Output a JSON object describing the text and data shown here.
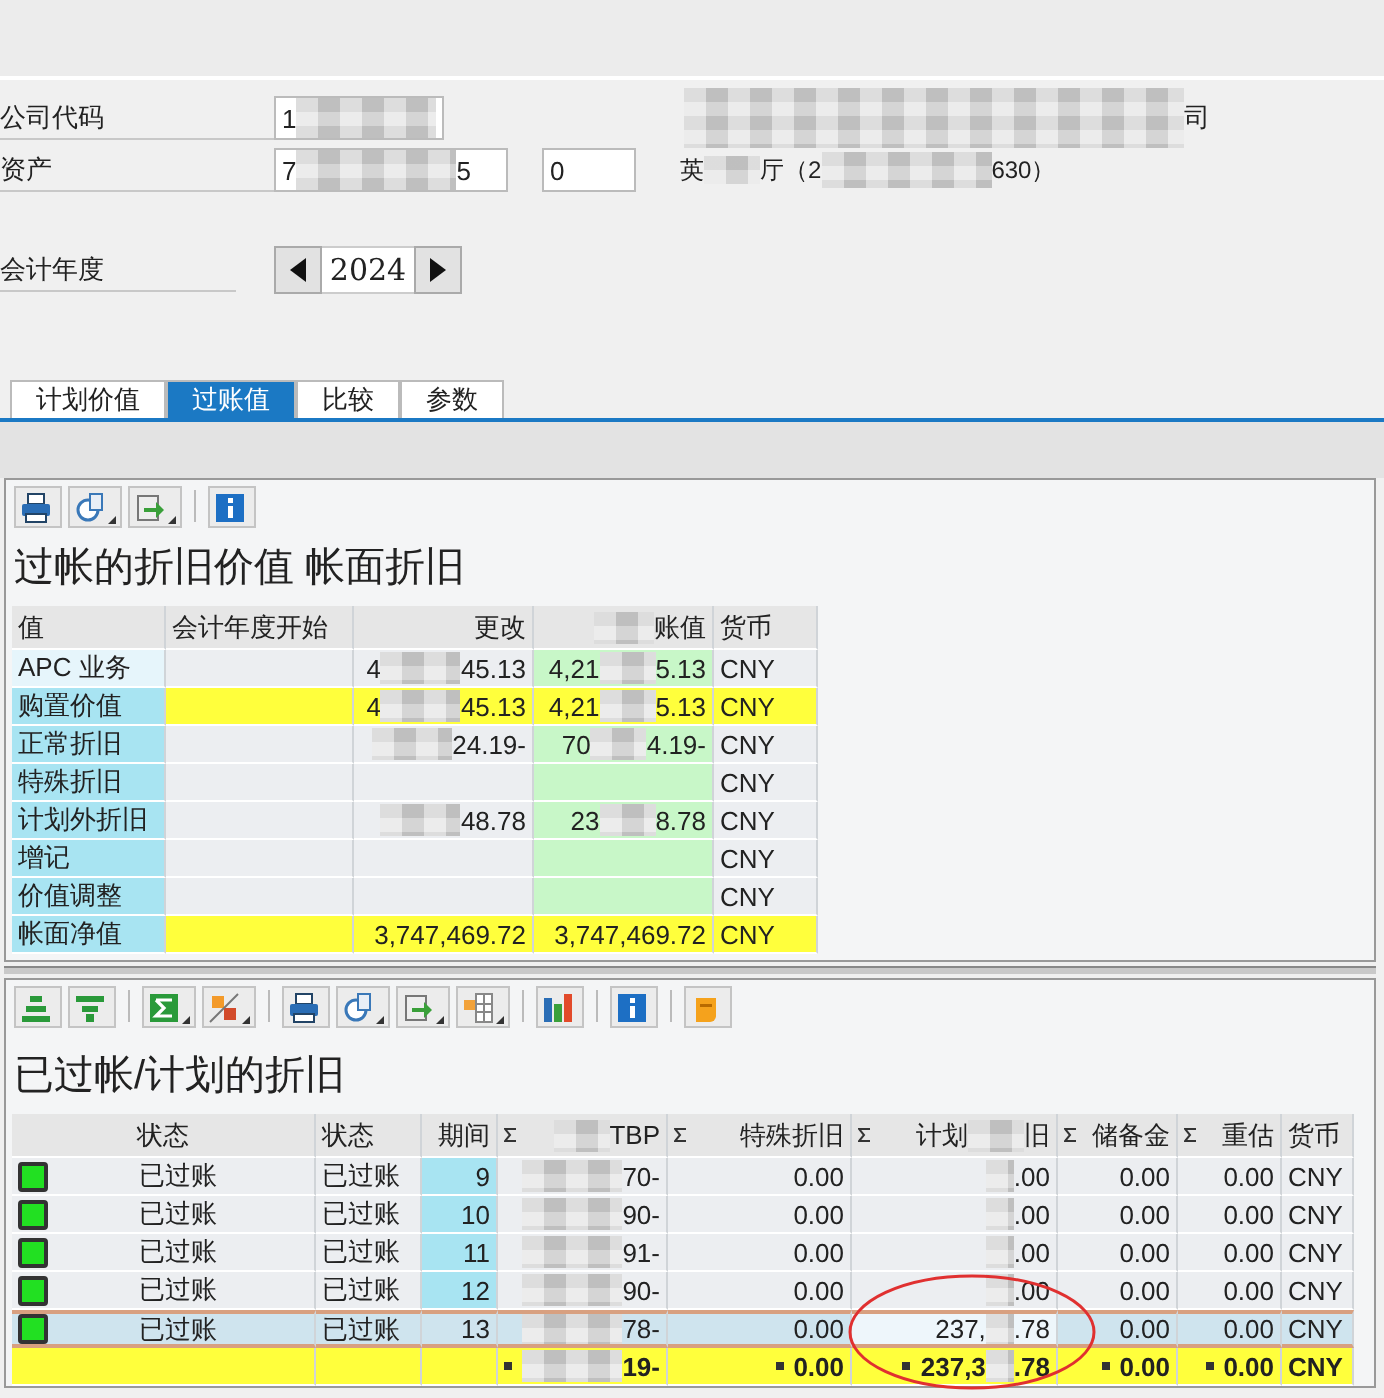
{
  "header": {
    "company_code": {
      "label": "公司代码",
      "value_start": "1",
      "description_end": "司"
    },
    "asset": {
      "label": "资产",
      "value_start": "7",
      "value_end": "5",
      "sub_number": "0",
      "description_parts": [
        "英",
        "厅（2",
        "630）"
      ]
    },
    "fiscal_year": {
      "label": "会计年度",
      "value": "2024"
    }
  },
  "tabs": [
    {
      "label": "计划价值",
      "selected": false
    },
    {
      "label": "过账值",
      "selected": true
    },
    {
      "label": "比较",
      "selected": false
    },
    {
      "label": "参数",
      "selected": false
    }
  ],
  "values_table": {
    "title": "过帐的折旧价值 帐面折旧",
    "columns": [
      {
        "label": "值"
      },
      {
        "label": "会计年度开始"
      },
      {
        "label": "更改"
      },
      {
        "after": "账值"
      },
      {
        "label": "货币"
      }
    ],
    "rows": [
      {
        "label": "APC 业务",
        "kind": "normal",
        "selected": true,
        "change": {
          "before": "4",
          "after": "45.13"
        },
        "posted": {
          "before": "4,21",
          "after": "5.13"
        },
        "currency": "CNY"
      },
      {
        "label": "购置价值",
        "kind": "highlight",
        "selected": false,
        "change": {
          "before": "4",
          "after": "45.13"
        },
        "posted": {
          "before": "4,21",
          "after": "5.13"
        },
        "currency": "CNY"
      },
      {
        "label": "正常折旧",
        "kind": "normal",
        "selected": false,
        "change": {
          "after": "24.19-"
        },
        "posted": {
          "before": "70",
          "after": "4.19-"
        },
        "currency": "CNY"
      },
      {
        "label": "特殊折旧",
        "kind": "normal",
        "selected": false,
        "currency": "CNY"
      },
      {
        "label": "计划外折旧",
        "kind": "normal",
        "selected": false,
        "change": {
          "after": "48.78"
        },
        "posted": {
          "before": "23",
          "after": "8.78"
        },
        "currency": "CNY"
      },
      {
        "label": "增记",
        "kind": "normal",
        "selected": false,
        "currency": "CNY"
      },
      {
        "label": "价值调整",
        "kind": "normal",
        "selected": false,
        "currency": "CNY"
      },
      {
        "label": "帐面净值",
        "kind": "highlight",
        "selected": false,
        "change": "3,747,469.72",
        "posted": "3,747,469.72",
        "currency": "CNY"
      }
    ]
  },
  "depreciation_table": {
    "title": "已过帐/计划的折旧",
    "columns": [
      {
        "label": "状态",
        "sum": false
      },
      {
        "label": "状态",
        "sum": false
      },
      {
        "label": "期间",
        "sum": false
      },
      {
        "after": "TBP",
        "sum": true
      },
      {
        "label": "特殊折旧",
        "sum": true
      },
      {
        "before": "计划",
        "after": "旧",
        "sum": true
      },
      {
        "label": "储备金",
        "sum": true
      },
      {
        "label": "重估",
        "sum": true
      },
      {
        "label": "货币",
        "sum": false
      }
    ],
    "rows": [
      {
        "color": "#22e022",
        "status": "已过账",
        "status_2": "已过账",
        "period": "9",
        "normal": {
          "after": "70-"
        },
        "special": "0.00",
        "planned": {
          "after": ".00"
        },
        "reserve": "0.00",
        "revaluation": "0.00",
        "currency": "CNY",
        "selected": false
      },
      {
        "color": "#22e022",
        "status": "已过账",
        "status_2": "已过账",
        "period": "10",
        "normal": {
          "after": "90-"
        },
        "special": "0.00",
        "planned": {
          "after": ".00"
        },
        "reserve": "0.00",
        "revaluation": "0.00",
        "currency": "CNY",
        "selected": false
      },
      {
        "color": "#22e022",
        "status": "已过账",
        "status_2": "已过账",
        "period": "11",
        "normal": {
          "after": "91-"
        },
        "special": "0.00",
        "planned": {
          "after": ".00"
        },
        "reserve": "0.00",
        "revaluation": "0.00",
        "currency": "CNY",
        "selected": false
      },
      {
        "color": "#22e022",
        "status": "已过账",
        "status_2": "已过账",
        "period": "12",
        "normal": {
          "after": "90-"
        },
        "special": "0.00",
        "planned": {
          "after": ".00"
        },
        "reserve": "0.00",
        "revaluation": "0.00",
        "currency": "CNY",
        "selected": false
      },
      {
        "color": "#22e022",
        "status": "已过账",
        "status_2": "已过账",
        "period": "13",
        "normal": {
          "after": "78-"
        },
        "special": "0.00",
        "planned": {
          "before": "237,",
          "after": ".78"
        },
        "reserve": "0.00",
        "revaluation": "0.00",
        "currency": "CNY",
        "selected": true
      }
    ],
    "total": {
      "normal": {
        "after": "19-"
      },
      "special": "0.00",
      "planned": {
        "before": "237,3",
        "after": ".78"
      },
      "reserve": "0.00",
      "revaluation": "0.00",
      "currency": "CNY"
    }
  }
}
